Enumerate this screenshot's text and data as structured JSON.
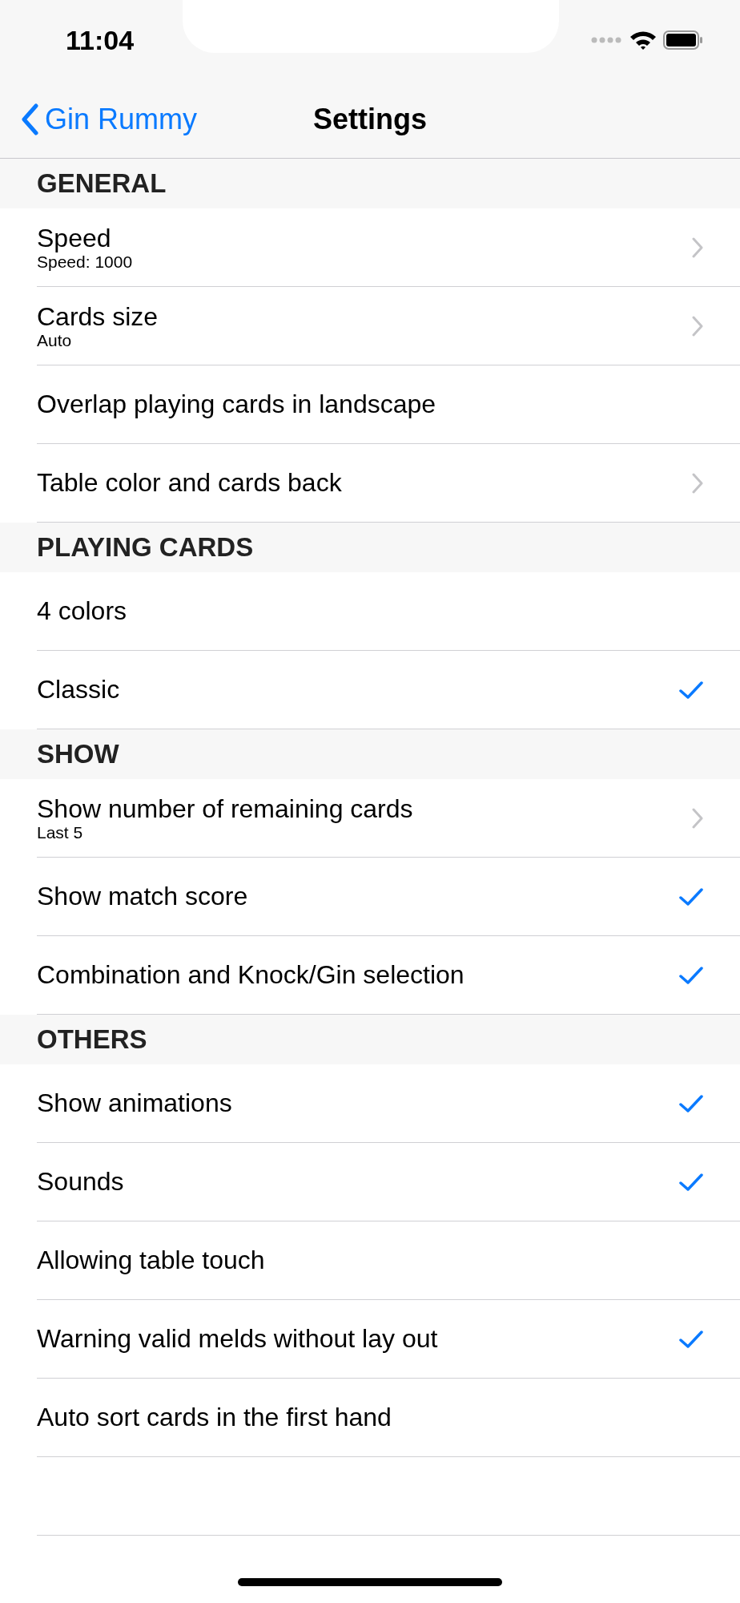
{
  "status_bar": {
    "time": "11:04"
  },
  "nav": {
    "back": "Gin Rummy",
    "title": "Settings"
  },
  "sections": [
    {
      "title": "GENERAL",
      "rows": [
        {
          "kind": "link",
          "title": "Speed",
          "subtitle": "Speed: 1000"
        },
        {
          "kind": "link",
          "title": "Cards size",
          "subtitle": "Auto"
        },
        {
          "kind": "check",
          "title": "Overlap playing cards in landscape",
          "checked": false
        },
        {
          "kind": "link",
          "title": "Table color and cards back"
        }
      ]
    },
    {
      "title": "PLAYING CARDS",
      "rows": [
        {
          "kind": "check",
          "title": "4 colors",
          "checked": false
        },
        {
          "kind": "check",
          "title": "Classic",
          "checked": true
        }
      ]
    },
    {
      "title": "SHOW",
      "rows": [
        {
          "kind": "link",
          "title": "Show number of remaining cards",
          "subtitle": "Last 5"
        },
        {
          "kind": "check",
          "title": "Show match score",
          "checked": true
        },
        {
          "kind": "check",
          "title": "Combination and Knock/Gin selection",
          "checked": true
        }
      ]
    },
    {
      "title": "OTHERS",
      "rows": [
        {
          "kind": "check",
          "title": "Show animations",
          "checked": true
        },
        {
          "kind": "check",
          "title": "Sounds",
          "checked": true
        },
        {
          "kind": "check",
          "title": "Allowing table touch",
          "checked": false
        },
        {
          "kind": "check",
          "title": "Warning valid melds without lay out",
          "checked": true
        },
        {
          "kind": "check",
          "title": "Auto sort cards in the first hand",
          "checked": false
        }
      ]
    }
  ]
}
